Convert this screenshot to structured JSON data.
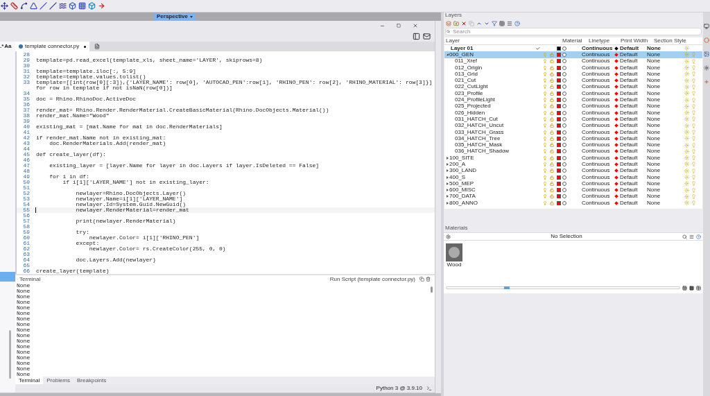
{
  "viewport": {
    "tab": "Perspective"
  },
  "editor": {
    "search_options": {
      "regex": ".*",
      "match_case": "Aa"
    },
    "tabs": [
      {
        "label": "template connector.py",
        "modified": true,
        "selected": true
      }
    ],
    "lines": [
      {
        "number": "28",
        "current": false
      },
      {
        "number": "29",
        "text": "template=pd.read_excel(template_xls, sheet_name='LAYER', skiprows=8)",
        "current": false
      },
      {
        "number": "30",
        "current": false
      },
      {
        "number": "31",
        "text": "template=template.iloc[:, 5:9]",
        "current": false
      },
      {
        "number": "32",
        "text": "template=template.values.tolist()",
        "current": false
      },
      {
        "number": "33",
        "text": "template=[[int(row[0][:3]),{'LAYER_NAME': row[0], 'AUTOCAD_PEN':row[1], 'RHINO_PEN': row[2], 'RHINO_MATERIAL': row[3]}] for row in template if not isNaN(row[0])]",
        "current": false
      },
      {
        "number": "34",
        "current": false
      },
      {
        "number": "35",
        "text": "doc = Rhino.RhinoDoc.ActiveDoc",
        "current": false
      },
      {
        "number": "36",
        "current": false
      },
      {
        "number": "37",
        "text": "render_mat= Rhino.Render.RenderMaterial.CreateBasicMaterial(Rhino.DocObjects.Material())",
        "current": false
      },
      {
        "number": "38",
        "text": "render_mat.Name=\"Wood\"",
        "current": false
      },
      {
        "number": "39",
        "current": false
      },
      {
        "number": "40",
        "text": "existing_mat = [mat.Name for mat in doc.RenderMaterials]",
        "current": false
      },
      {
        "number": "41",
        "current": false
      },
      {
        "number": "42",
        "text": "if render_mat.Name not in existing_mat:",
        "current": false
      },
      {
        "number": "43",
        "text": "    doc.RenderMaterials.Add(render_mat)",
        "current": false
      },
      {
        "number": "44",
        "current": false
      },
      {
        "number": "45",
        "text": "def create_layer(df):",
        "current": false
      },
      {
        "number": "46",
        "current": false
      },
      {
        "number": "47",
        "text": "    existing_layer = [layer.Name for layer in doc.Layers if layer.IsDeleted == False]",
        "current": false
      },
      {
        "number": "48",
        "current": false
      },
      {
        "number": "49",
        "text": "    for i in df:",
        "current": false
      },
      {
        "number": "50",
        "text": "        if i[1]['LAYER_NAME'] not in existing_layer:",
        "current": false
      },
      {
        "number": "51",
        "current": false
      },
      {
        "number": "52",
        "text": "            newlayer=Rhino.DocObjects.Layer()",
        "current": false
      },
      {
        "number": "53",
        "text": "            newlayer.Name=i[1]['LAYER_NAME']",
        "current": false
      },
      {
        "number": "54",
        "text": "            newlayer.Id=System.Guid.NewGuid()",
        "current": false
      },
      {
        "number": "55",
        "text": "            newlayer.RenderMaterial=render_mat",
        "current": true
      },
      {
        "number": "56",
        "current": false
      },
      {
        "number": "57",
        "text": "            print(newlayer.RenderMaterial)",
        "current": false
      },
      {
        "number": "58",
        "current": false
      },
      {
        "number": "59",
        "text": "            try:",
        "current": false
      },
      {
        "number": "60",
        "text": "                newlayer.Color= i[1]['RHINO_PEN']",
        "current": false
      },
      {
        "number": "61",
        "text": "            except:",
        "current": false
      },
      {
        "number": "62",
        "text": "                newlayer.Color= rs.CreateColor(255, 0, 0)",
        "current": false
      },
      {
        "number": "63",
        "current": false
      },
      {
        "number": "64",
        "text": "            doc.Layers.Add(newlayer)",
        "current": false
      },
      {
        "number": "65",
        "current": false
      },
      {
        "number": "66",
        "text": "create_layer(template)",
        "current": false
      }
    ],
    "terminal": {
      "title": "Terminal",
      "run_label": "Run Script (template connector.py)",
      "output": [
        "None",
        "None",
        "None",
        "None",
        "None",
        "None",
        "None",
        "None",
        "None",
        "None",
        "None",
        "None",
        "None",
        "None",
        "None",
        "None",
        "None"
      ]
    },
    "bottom_tabs": [
      {
        "label": "Terminal",
        "selected": true
      },
      {
        "label": "Problems",
        "selected": false
      },
      {
        "label": "Breakpoints",
        "selected": false
      }
    ],
    "status": "Python 3 @ 3.9.10"
  },
  "layers": {
    "title": "Layers",
    "search": {
      "placeholder": "Search"
    },
    "columns": [
      "Layer",
      "Material",
      "Linetype",
      "Print Width",
      "Section Style"
    ],
    "rows": [
      {
        "name": "Layer 01",
        "current": true,
        "selected": false,
        "color": "#000000",
        "linetype": "Continuous",
        "print_width": "Default",
        "section_style": "None"
      },
      {
        "name": "000_GEN",
        "current": false,
        "selected": true,
        "expanded": true,
        "color": "#ff0000",
        "linetype": "Continuous",
        "print_width": "Default",
        "section_style": "None",
        "children": [
          {
            "name": "011_Xref",
            "current": false,
            "selected": false,
            "color": "#ff0000",
            "linetype": "Continuous",
            "print_width": "Default",
            "section_style": "None"
          },
          {
            "name": "012_Origin",
            "current": false,
            "selected": false,
            "color": "#ff0000",
            "linetype": "Continuous",
            "print_width": "Default",
            "section_style": "None"
          },
          {
            "name": "013_Grid",
            "current": false,
            "selected": false,
            "color": "#ff0000",
            "linetype": "Continuous",
            "print_width": "Default",
            "section_style": "None"
          },
          {
            "name": "021_Cut",
            "current": false,
            "selected": false,
            "color": "#ff0000",
            "linetype": "Continuous",
            "print_width": "Default",
            "section_style": "None"
          },
          {
            "name": "022_CutLight",
            "current": false,
            "selected": false,
            "color": "#ff0000",
            "linetype": "Continuous",
            "print_width": "Default",
            "section_style": "None"
          },
          {
            "name": "023_Profile",
            "current": false,
            "selected": false,
            "color": "#ff0000",
            "linetype": "Continuous",
            "print_width": "Default",
            "section_style": "None"
          },
          {
            "name": "024_ProfileLight",
            "current": false,
            "selected": false,
            "color": "#ff0000",
            "linetype": "Continuous",
            "print_width": "Default",
            "section_style": "None"
          },
          {
            "name": "025_Projected",
            "current": false,
            "selected": false,
            "color": "#ff0000",
            "linetype": "Continuous",
            "print_width": "Default",
            "section_style": "None"
          },
          {
            "name": "026_Hidden",
            "current": false,
            "selected": false,
            "color": "#ff0000",
            "linetype": "Continuous",
            "print_width": "Default",
            "section_style": "None"
          },
          {
            "name": "031_HATCH_Cut",
            "current": false,
            "selected": false,
            "color": "#ff0000",
            "linetype": "Continuous",
            "print_width": "Default",
            "section_style": "None"
          },
          {
            "name": "032_HATCH_Uncut",
            "current": false,
            "selected": false,
            "color": "#ff0000",
            "linetype": "Continuous",
            "print_width": "Default",
            "section_style": "None"
          },
          {
            "name": "033_HATCH_Grass",
            "current": false,
            "selected": false,
            "color": "#ff0000",
            "linetype": "Continuous",
            "print_width": "Default",
            "section_style": "None"
          },
          {
            "name": "034_HATCH_Tree",
            "current": false,
            "selected": false,
            "color": "#ff0000",
            "linetype": "Continuous",
            "print_width": "Default",
            "section_style": "None"
          },
          {
            "name": "035_HATCH_Mask",
            "current": false,
            "selected": false,
            "color": "#ff0000",
            "linetype": "Continuous",
            "print_width": "Default",
            "section_style": "None"
          },
          {
            "name": "036_HATCH_Shadow",
            "current": false,
            "selected": false,
            "color": "#ff0000",
            "linetype": "Continuous",
            "print_width": "Default",
            "section_style": "None"
          }
        ]
      },
      {
        "name": "100_SITE",
        "current": false,
        "selected": false,
        "expanded": false,
        "color": "#ff0000",
        "linetype": "Continuous",
        "print_width": "Default",
        "section_style": "None"
      },
      {
        "name": "200_A",
        "current": false,
        "selected": false,
        "expanded": false,
        "color": "#ff0000",
        "linetype": "Continuous",
        "print_width": "Default",
        "section_style": "None"
      },
      {
        "name": "300_LAND",
        "current": false,
        "selected": false,
        "expanded": false,
        "color": "#ff0000",
        "linetype": "Continuous",
        "print_width": "Default",
        "section_style": "None"
      },
      {
        "name": "400_S",
        "current": false,
        "selected": false,
        "expanded": false,
        "color": "#ff0000",
        "linetype": "Continuous",
        "print_width": "Default",
        "section_style": "None"
      },
      {
        "name": "500_MEP",
        "current": false,
        "selected": false,
        "expanded": false,
        "color": "#ff0000",
        "linetype": "Continuous",
        "print_width": "Default",
        "section_style": "None"
      },
      {
        "name": "600_MISC",
        "current": false,
        "selected": false,
        "expanded": false,
        "color": "#ff0000",
        "linetype": "Continuous",
        "print_width": "Default",
        "section_style": "None"
      },
      {
        "name": "700_DATA",
        "current": false,
        "selected": false,
        "expanded": false,
        "color": "#ff0000",
        "linetype": "Continuous",
        "print_width": "Default",
        "section_style": "None"
      },
      {
        "name": "800_ANNO",
        "current": false,
        "selected": false,
        "expanded": false,
        "color": "#ff0000",
        "linetype": "Continuous",
        "print_width": "Default",
        "section_style": "None"
      }
    ]
  },
  "materials": {
    "title": "Materials",
    "selection": "No Selection",
    "items": [
      {
        "name": "Wood"
      }
    ],
    "zoom_slider": {
      "level": 0.26
    }
  }
}
